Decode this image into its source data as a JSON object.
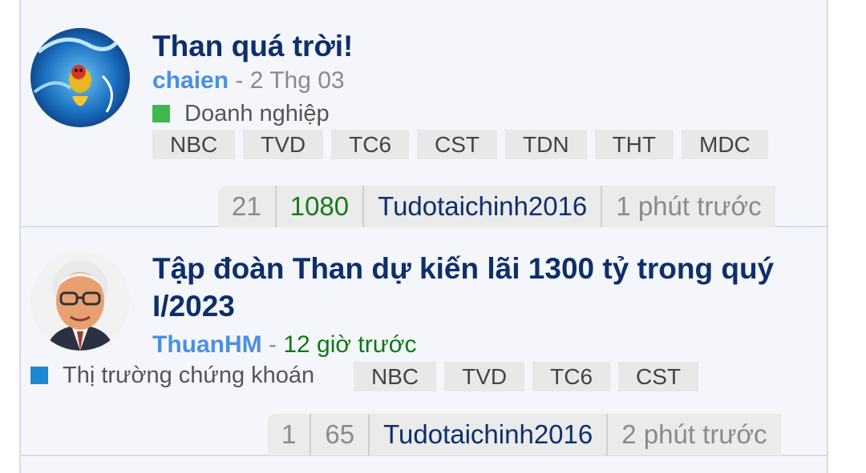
{
  "threads": [
    {
      "title": "Than quá trời!",
      "author": "chaien",
      "separator": " - ",
      "time": "2 Thg 03",
      "category": {
        "label": "Doanh nghiệp",
        "color": "#3dba4e"
      },
      "tags": [
        "NBC",
        "TVD",
        "TC6",
        "CST",
        "TDN",
        "THT",
        "MDC"
      ],
      "stats": {
        "replies": "21",
        "views": "1080",
        "last_user": "Tudotaichinh2016",
        "last_time": "1 phút trước"
      }
    },
    {
      "title": "Tập đoàn Than dự kiến lãi 1300 tỷ trong quý I/2023",
      "author": "ThuanHM",
      "separator": " - ",
      "time": "12 giờ trước",
      "category": {
        "label": "Thị trường chứng khoán",
        "color": "#1e88d2"
      },
      "tags": [
        "NBC",
        "TVD",
        "TC6",
        "CST"
      ],
      "stats": {
        "replies": "1",
        "views": "65",
        "last_user": "Tudotaichinh2016",
        "last_time": "2 phút trước"
      }
    }
  ]
}
